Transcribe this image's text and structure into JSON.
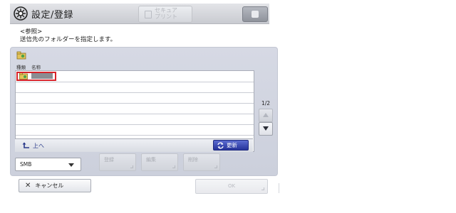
{
  "header": {
    "title": "設定/登録",
    "secure_print": "セキュア\nプリント"
  },
  "instruction": {
    "section": "<参照>",
    "text": "送信先のフォルダーを指定します。"
  },
  "list": {
    "columns": [
      "種類",
      "名称"
    ],
    "page_indicator": "1/2",
    "up_label": "上へ",
    "refresh_label": "更新"
  },
  "protocol": {
    "selected": "SMB"
  },
  "actions": {
    "register": "登録",
    "edit": "編集",
    "delete": "削除"
  },
  "footer": {
    "cancel": "キャンセル",
    "ok": "OK"
  },
  "colors": {
    "highlight": "#d8232a",
    "refresh": "#2b38a3"
  }
}
